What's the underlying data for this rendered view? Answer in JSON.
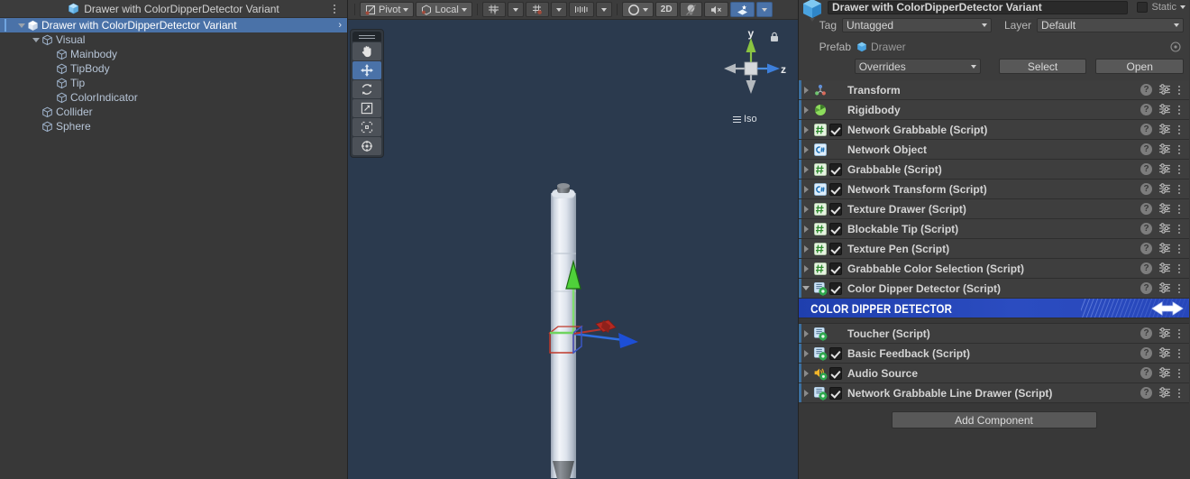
{
  "hierarchy": {
    "tab_label": "Drawer with ColorDipperDetector Variant",
    "tab_icon": "prefab-variant-icon",
    "menu_icon": "kebab-menu-icon",
    "items": [
      {
        "label": "Drawer with ColorDipperDetector Variant",
        "indent": 0,
        "selected": true,
        "expanded": true,
        "icon": "prefab-icon",
        "chevron": "›"
      },
      {
        "label": "Visual",
        "indent": 1,
        "selected": false,
        "expanded": true,
        "icon": "gameobject-icon",
        "chevron": ""
      },
      {
        "label": "Mainbody",
        "indent": 2,
        "selected": false,
        "expanded": false,
        "icon": "gameobject-icon",
        "chevron": ""
      },
      {
        "label": "TipBody",
        "indent": 2,
        "selected": false,
        "expanded": false,
        "icon": "gameobject-icon",
        "chevron": ""
      },
      {
        "label": "Tip",
        "indent": 2,
        "selected": false,
        "expanded": false,
        "icon": "gameobject-icon",
        "chevron": ""
      },
      {
        "label": "ColorIndicator",
        "indent": 2,
        "selected": false,
        "expanded": false,
        "icon": "gameobject-icon",
        "chevron": ""
      },
      {
        "label": "Collider",
        "indent": 1,
        "selected": false,
        "expanded": false,
        "icon": "gameobject-icon",
        "chevron": ""
      },
      {
        "label": "Sphere",
        "indent": 1,
        "selected": false,
        "expanded": false,
        "icon": "gameobject-icon",
        "chevron": ""
      }
    ]
  },
  "scene": {
    "toolbar": {
      "pivot_label": "Pivot",
      "space_label": "Local",
      "twod_label": "2D",
      "grid_axis_icon": "grid-axis-y-icon",
      "grid_snap_icon": "grid-snapping-icon",
      "snap_increment_icon": "snap-increment-icon",
      "shading_icon": "shading-mode-icon",
      "lighting_icon": "scene-lighting-icon",
      "audio_icon": "scene-audio-mute-icon",
      "fx_icon": "scene-effects-icon"
    },
    "tools": [
      {
        "name": "hand-tool",
        "icon": "hand-icon",
        "selected": false
      },
      {
        "name": "move-tool",
        "icon": "move-icon",
        "selected": true
      },
      {
        "name": "rotate-tool",
        "icon": "rotate-icon",
        "selected": false
      },
      {
        "name": "scale-tool",
        "icon": "scale-icon",
        "selected": false
      },
      {
        "name": "rect-tool",
        "icon": "rect-icon",
        "selected": false
      },
      {
        "name": "transform-tool",
        "icon": "transform-icon",
        "selected": false
      }
    ],
    "gizmo": {
      "axis_y_label": "y",
      "axis_z_label": "z",
      "projection_label": "Iso",
      "lock_icon": "lock-icon"
    },
    "object": "pen-drawer-3d-model"
  },
  "inspector": {
    "object_name": "Drawer with ColorDipperDetector Variant",
    "static_label": "Static",
    "tag_label": "Tag",
    "tag_value": "Untagged",
    "layer_label": "Layer",
    "layer_value": "Default",
    "prefab_label": "Prefab",
    "prefab_value": "Drawer",
    "overrides_label": "Overrides",
    "select_label": "Select",
    "open_label": "Open",
    "add_component_label": "Add Component",
    "components": [
      {
        "name": "Transform",
        "icon": "transform-component-icon",
        "has_checkbox": false,
        "checked": false,
        "expanded": false
      },
      {
        "name": "Rigidbody",
        "icon": "rigidbody-icon",
        "has_checkbox": false,
        "checked": false,
        "expanded": false
      },
      {
        "name": "Network Grabbable (Script)",
        "icon": "script-hash-icon",
        "has_checkbox": true,
        "checked": true,
        "expanded": false
      },
      {
        "name": "Network Object",
        "icon": "csharp-blue-icon",
        "has_checkbox": false,
        "checked": false,
        "expanded": false
      },
      {
        "name": "Grabbable (Script)",
        "icon": "script-hash-icon",
        "has_checkbox": true,
        "checked": true,
        "expanded": false
      },
      {
        "name": "Network Transform (Script)",
        "icon": "csharp-blue-icon",
        "has_checkbox": true,
        "checked": true,
        "expanded": false
      },
      {
        "name": "Texture Drawer (Script)",
        "icon": "script-hash-icon",
        "has_checkbox": true,
        "checked": true,
        "expanded": false
      },
      {
        "name": "Blockable Tip (Script)",
        "icon": "script-hash-icon",
        "has_checkbox": true,
        "checked": true,
        "expanded": false
      },
      {
        "name": "Texture Pen (Script)",
        "icon": "script-hash-icon",
        "has_checkbox": true,
        "checked": true,
        "expanded": false
      },
      {
        "name": "Grabbable Color Selection (Script)",
        "icon": "script-hash-icon",
        "has_checkbox": true,
        "checked": true,
        "expanded": false
      },
      {
        "name": "Color Dipper Detector (Script)",
        "icon": "script-green-gear-icon",
        "has_checkbox": true,
        "checked": true,
        "expanded": true
      }
    ],
    "banner": {
      "title": "COLOR DIPPER DETECTOR",
      "icon": "double-arrow-icon",
      "color": "#2b4cc0"
    },
    "components_after": [
      {
        "name": "Toucher (Script)",
        "icon": "script-green-gear-icon",
        "has_checkbox": false,
        "checked": false,
        "expanded": false
      },
      {
        "name": "Basic Feedback (Script)",
        "icon": "script-green-gear-icon",
        "has_checkbox": true,
        "checked": true,
        "expanded": false
      },
      {
        "name": "Audio Source",
        "icon": "audio-source-icon",
        "has_checkbox": true,
        "checked": true,
        "expanded": false
      },
      {
        "name": "Network Grabbable Line Drawer (Script)",
        "icon": "script-green-gear-icon",
        "has_checkbox": true,
        "checked": true,
        "expanded": false
      }
    ],
    "row_icons": {
      "help": "?",
      "preset": "preset-icon",
      "menu": "kebab-menu-icon"
    }
  },
  "colors": {
    "selection_blue": "#4a72a8",
    "banner_blue": "#2b4cc0",
    "scene_bg": "#2b3a4e",
    "panel_bg": "#383838",
    "row_bg": "#3e3e3e"
  }
}
